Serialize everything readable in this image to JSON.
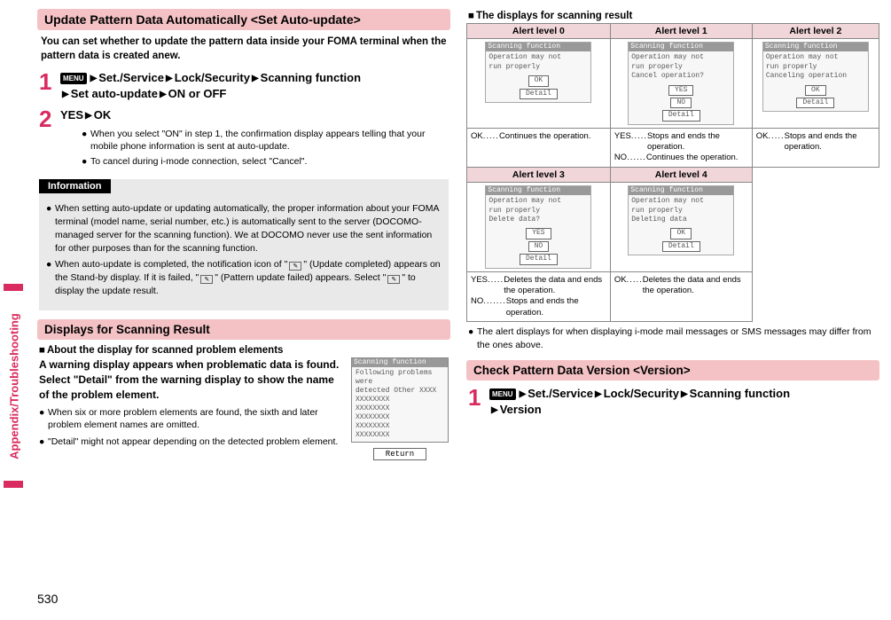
{
  "sideTab": "Appendix/Troubleshooting",
  "pageNumber": "530",
  "left": {
    "section1": {
      "title": "Update Pattern Data Automatically <Set Auto-update>",
      "intro": "You can set whether to update the pattern data inside your FOMA terminal when the pattern data is created anew.",
      "step1": {
        "menu": "MENU",
        "p1": "Set./Service",
        "p2": "Lock/Security",
        "p3": "Scanning function",
        "p4": "Set auto-update",
        "p5": "ON or OFF"
      },
      "step2": {
        "line": "YES",
        "ok": "OK",
        "b1": "When you select \"ON\" in step 1, the confirmation display appears telling that your mobile phone information is sent at auto-update.",
        "b2": "To cancel during i-mode connection, select \"Cancel\"."
      },
      "info": {
        "hdr": "Information",
        "b1": "When setting auto-update or updating automatically, the proper information about your FOMA terminal (model name, serial number, etc.) is automatically sent to the server (DOCOMO-managed server for the scanning function). We at DOCOMO never use the sent information for other purposes than for the scanning function.",
        "b2a": "When auto-update is completed, the notification icon of \"",
        "b2b": "\" (Update completed) appears on the Stand-by display. If it is failed, \"",
        "b2c": "\" (Pattern update failed) appears. Select \"",
        "b2d": "\" to display the update result."
      }
    },
    "section2": {
      "title": "Displays for Scanning Result",
      "sub": "About the display for scanned problem elements",
      "lead": "A warning display appears when problematic data is found. Select \"Detail\" from the warning display to show the name of the problem element.",
      "b1": "When six or more problem elements are found, the sixth and later problem element names are omitted.",
      "b2": "\"Detail\" might not appear depending on the detected problem element.",
      "screen": {
        "title": "Scanning function",
        "l1": "Following problems were",
        "l2": "detected        Other XXXX",
        "l3": "XXXXXXXX",
        "l4": "XXXXXXXX",
        "l5": "XXXXXXXX",
        "l6": "XXXXXXXX",
        "l7": "XXXXXXXX",
        "ret": "Return"
      }
    }
  },
  "right": {
    "heading": "The displays for scanning result",
    "cols": {
      "a0": "Alert level 0",
      "a1": "Alert level 1",
      "a2": "Alert level 2",
      "a3": "Alert level 3",
      "a4": "Alert level 4"
    },
    "screens": {
      "scanTitle": "Scanning function",
      "l0a": "Operation may not",
      "l0b": "run properly",
      "l1c": "Cancel operation?",
      "l2c": "Canceling operation",
      "l3c": "Delete data?",
      "l4c": "Deleting data",
      "ok": "OK",
      "detail": "Detail",
      "yes": "YES",
      "no": "NO"
    },
    "desc": {
      "ok": "OK",
      "yes": "YES",
      "no": "NO",
      "dots5": ".....",
      "dots6": "......",
      "dots7": ".......",
      "contOp": "Continues the operation.",
      "stopEnd": "Stops and ends the operation.",
      "delEnd": "Deletes the data and ends the operation."
    },
    "footnote": "The alert displays for when displaying i-mode mail messages or SMS messages may differ from the ones above.",
    "section3": {
      "title": "Check Pattern Data Version <Version>",
      "menu": "MENU",
      "p1": "Set./Service",
      "p2": "Lock/Security",
      "p3": "Scanning function",
      "p4": "Version"
    }
  }
}
